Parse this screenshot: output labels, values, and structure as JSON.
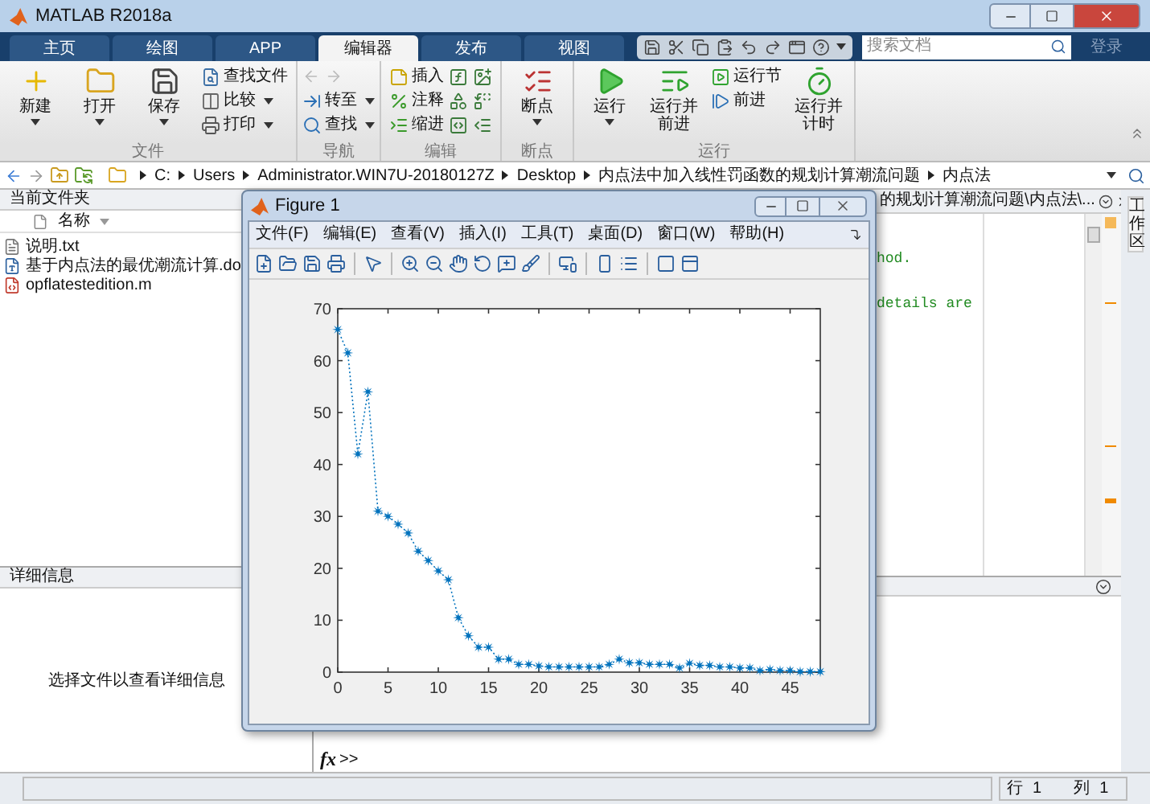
{
  "window": {
    "title": "MATLAB R2018a"
  },
  "tabs": [
    {
      "label": "主页",
      "selected": false
    },
    {
      "label": "绘图",
      "selected": false
    },
    {
      "label": "APP",
      "selected": false
    },
    {
      "label": "编辑器",
      "selected": true
    },
    {
      "label": "发布",
      "selected": false
    },
    {
      "label": "视图",
      "selected": false
    }
  ],
  "search": {
    "placeholder": "搜索文档"
  },
  "login": "登录",
  "ribbon": {
    "groups": [
      {
        "label": "文件",
        "items": [
          {
            "kind": "large",
            "label": "新建",
            "dropdown": true
          },
          {
            "kind": "large",
            "label": "打开",
            "dropdown": true
          },
          {
            "kind": "large",
            "label": "保存",
            "dropdown": true
          },
          {
            "kind": "small",
            "label": "查找文件",
            "dropdown": false
          },
          {
            "kind": "small",
            "label": "比较",
            "dropdown": true
          },
          {
            "kind": "small",
            "label": "打印",
            "dropdown": true
          }
        ]
      },
      {
        "label": "导航",
        "items": [
          {
            "kind": "small",
            "label": "转至",
            "dropdown": true
          },
          {
            "kind": "small",
            "label": "查找",
            "dropdown": true
          }
        ]
      },
      {
        "label": "编辑",
        "items": [
          {
            "kind": "small",
            "label": "插入",
            "dropdown": false
          },
          {
            "kind": "small",
            "label": "注释",
            "dropdown": false
          },
          {
            "kind": "small",
            "label": "缩进",
            "dropdown": false
          }
        ]
      },
      {
        "label": "断点",
        "items": [
          {
            "kind": "large",
            "label": "断点",
            "dropdown": true
          }
        ]
      },
      {
        "label": "运行",
        "items": [
          {
            "kind": "large",
            "label": "运行",
            "dropdown": true
          },
          {
            "kind": "large",
            "label": "运行并前进",
            "dropdown": false
          },
          {
            "kind": "small",
            "label": "运行节",
            "dropdown": false
          },
          {
            "kind": "small",
            "label": "前进",
            "dropdown": false
          },
          {
            "kind": "large",
            "label": "运行并计时",
            "dropdown": false
          }
        ]
      }
    ]
  },
  "address_bar": {
    "path": [
      "C:",
      "Users",
      "Administrator.WIN7U-20180127Z",
      "Desktop",
      "内点法中加入线性罚函数的规划计算潮流问题",
      "内点法"
    ]
  },
  "current_folder": {
    "title": "当前文件夹",
    "column": "名称",
    "files": [
      {
        "kind": "txt",
        "name": "说明.txt"
      },
      {
        "kind": "doc",
        "name": "基于内点法的最优潮流计算.do"
      },
      {
        "kind": "m",
        "name": "opflatestedition.m"
      }
    ]
  },
  "details": {
    "title": "详细信息",
    "message": "选择文件以查看详细信息"
  },
  "editor": {
    "tab_title": "的规划计算潮流问题\\内点法\\...",
    "lines": [
      "hod.",
      "details are"
    ]
  },
  "command_window": {
    "fx": "fx",
    "prompt": ">>"
  },
  "workspace_tab": "工作区",
  "status_bar": {
    "line_label": "行",
    "line": "1",
    "column_label": "列",
    "column": "1"
  },
  "figure": {
    "title": "Figure 1",
    "menu": [
      "文件(F)",
      "编辑(E)",
      "查看(V)",
      "插入(I)",
      "工具(T)",
      "桌面(D)",
      "窗口(W)",
      "帮助(H)"
    ],
    "chart_data": {
      "type": "line",
      "xlim": [
        0,
        48
      ],
      "ylim": [
        0,
        70
      ],
      "xticks": [
        0,
        5,
        10,
        15,
        20,
        25,
        30,
        35,
        40,
        45
      ],
      "yticks": [
        0,
        10,
        20,
        30,
        40,
        50,
        60,
        70
      ],
      "x": [
        0,
        1,
        2,
        3,
        4,
        5,
        6,
        7,
        8,
        9,
        10,
        11,
        12,
        13,
        14,
        15,
        16,
        17,
        18,
        19,
        20,
        21,
        22,
        23,
        24,
        25,
        26,
        27,
        28,
        29,
        30,
        31,
        32,
        33,
        34,
        35,
        36,
        37,
        38,
        39,
        40,
        41,
        42,
        43,
        44,
        45,
        46,
        47,
        48
      ],
      "series": [
        {
          "color": "#0072bd",
          "line_style": "dotted",
          "marker": "star",
          "values": [
            66,
            61.5,
            42,
            54,
            31,
            30,
            28.5,
            26.8,
            23.3,
            21.5,
            19.5,
            17.8,
            10.5,
            7,
            4.8,
            4.8,
            2.5,
            2.5,
            1.5,
            1.5,
            1.2,
            1,
            1,
            1,
            1,
            1,
            1,
            1.5,
            2.5,
            1.8,
            1.8,
            1.5,
            1.5,
            1.5,
            0.8,
            1.7,
            1.3,
            1.3,
            1,
            1,
            0.8,
            0.8,
            0.3,
            0.5,
            0.3,
            0.3,
            0.1,
            0.1,
            0.1
          ]
        }
      ]
    }
  }
}
